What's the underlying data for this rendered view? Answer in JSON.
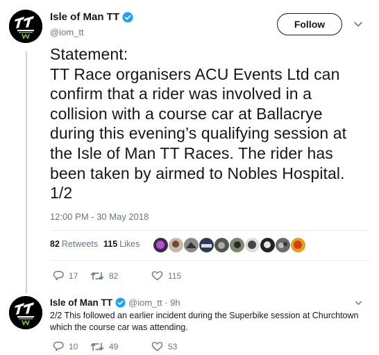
{
  "tweet": {
    "author_name": "Isle of Man TT",
    "handle": "@iom_tt",
    "follow_label": "Follow",
    "text": "Statement:\nTT Race organisers ACU Events Ltd can confirm that a rider was involved in a collision with a course car at Ballacrye during this evening’s qualifying session at the Isle of Man TT Races. The rider has been taken by airmed to Nobles Hospital. 1/2",
    "timestamp": "12:00 PM - 30 May 2018",
    "retweets_count": "82",
    "retweets_label": "Retweets",
    "likes_count": "115",
    "likes_label": "Likes",
    "actions": {
      "replies": "17",
      "retweets": "82",
      "likes": "115"
    }
  },
  "reply": {
    "author_name": "Isle of Man TT",
    "meta": "@iom_tt · 9h",
    "text": "2/2 This followed an earlier incident during the Superbike session at Churchtown which the course car was attending.",
    "actions": {
      "replies": "10",
      "retweets": "49",
      "likes": "53"
    }
  },
  "colors": {
    "verified": "#1da1f2",
    "muted": "#657786",
    "text": "#14171a",
    "thread_line": "#ccd6dd"
  },
  "icons": {
    "reply": "speech-bubble-icon",
    "retweet": "retweet-arrows-icon",
    "like": "heart-icon",
    "verified": "verified-badge-icon",
    "menu": "chevron-down-icon"
  }
}
